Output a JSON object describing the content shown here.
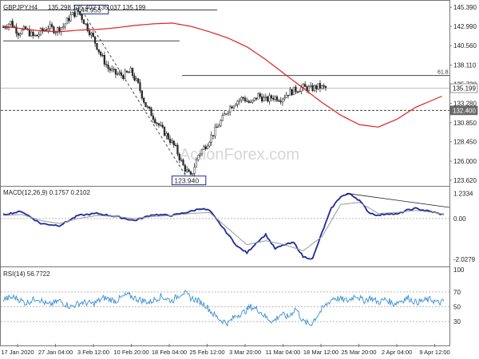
{
  "colors": {
    "candle": "#2b2b2b",
    "ma": "#e02020",
    "macd": "#1f2a9a",
    "signal": "#9a9a9a",
    "rsi": "#3a8fd6",
    "level": "#444444",
    "grid": "#b8b8b8",
    "watermark": "#d6d6d6",
    "box_border": "#1f2a9a"
  },
  "chart_data": [
    {
      "type": "candlestick",
      "title": "GBPJPY,H4",
      "ohlc_label": "135.298 135.402 135.037 135.199",
      "watermark": "ActionForex.com",
      "y_ticks": [
        "145.390",
        "142.990",
        "140.560",
        "138.110",
        "135.720",
        "133.280",
        "130.850",
        "128.450",
        "126.000",
        "123.620"
      ],
      "ylim": [
        123.0,
        146.0
      ],
      "levels": [
        {
          "label": "144.955",
          "value": 144.955
        },
        {
          "label": "123.940",
          "value": 123.94
        },
        {
          "label": "61.8",
          "value": 136.8
        },
        {
          "label": "132.400",
          "value": 132.4
        }
      ],
      "last_price_label": "135.199",
      "last_price": 135.199,
      "close_path": {
        "t": [
          0,
          4,
          8,
          12,
          16,
          18,
          20,
          24,
          28,
          32,
          36,
          40,
          44,
          48,
          52,
          56,
          60,
          64,
          68,
          72,
          76,
          80,
          84,
          88,
          92,
          96,
          100,
          104,
          108,
          112,
          116,
          120,
          124,
          128,
          132,
          136,
          140,
          144,
          148,
          152,
          156,
          160,
          164,
          168,
          172,
          176,
          180,
          184,
          188,
          192,
          196,
          200,
          204,
          208,
          212,
          216,
          220,
          224,
          228,
          232,
          235
        ],
        "values": [
          142.9,
          143.5,
          142.2,
          142.6,
          141.7,
          141.8,
          142.3,
          142.9,
          142.5,
          143.0,
          144.3,
          144.9,
          143.2,
          141.5,
          139.4,
          137.7,
          137.0,
          136.8,
          137.3,
          135.6,
          133.0,
          131.6,
          130.2,
          129.0,
          127.6,
          125.4,
          124.0,
          126.8,
          128.0,
          129.5,
          131.0,
          132.6,
          133.5,
          134.0,
          133.2,
          134.3,
          133.7,
          134.1,
          133.9,
          134.6,
          135.0,
          135.3,
          135.1,
          135.4,
          135.2
        ]
      },
      "ma_path": {
        "t": [
          0,
          10,
          20,
          30,
          40,
          50,
          60,
          70,
          80,
          90,
          100,
          110,
          120,
          130,
          140,
          150,
          160,
          170,
          180,
          190,
          200,
          210,
          220,
          230,
          235
        ],
        "values": [
          143.0,
          142.7,
          142.4,
          142.3,
          142.5,
          142.6,
          142.8,
          143.1,
          143.3,
          143.4,
          143.0,
          142.3,
          141.5,
          140.4,
          138.8,
          137.0,
          135.2,
          133.4,
          131.8,
          130.6,
          130.3,
          131.3,
          132.8,
          133.8,
          134.3
        ]
      }
    },
    {
      "type": "line",
      "title": "MACD(12,26,9) 0.1757 0.2102",
      "y_ticks": [
        "1.2334",
        "0.00",
        "-2.0279"
      ],
      "ylim": [
        -2.3,
        1.5
      ],
      "series": [
        {
          "name": "",
          "key": "macd",
          "t": [
            0,
            10,
            20,
            30,
            40,
            50,
            60,
            70,
            80,
            90,
            100,
            105,
            110,
            115,
            120,
            125,
            130,
            135,
            140,
            145,
            150,
            155,
            160,
            165,
            170,
            175,
            180,
            185,
            190,
            195,
            200,
            205,
            210,
            215,
            220,
            225,
            230,
            235
          ],
          "values": [
            0.2,
            0.35,
            -0.25,
            -0.35,
            0.15,
            0.25,
            0.1,
            -0.1,
            0.2,
            0.15,
            0.35,
            0.5,
            0.4,
            -0.2,
            -0.8,
            -1.4,
            -1.7,
            -1.2,
            -0.8,
            -1.5,
            -1.3,
            -1.2,
            -1.9,
            -2.0,
            -0.7,
            0.5,
            1.1,
            1.23,
            0.9,
            0.3,
            0.15,
            0.25,
            0.2,
            0.4,
            0.5,
            0.4,
            0.3,
            0.18
          ]
        },
        {
          "name": "",
          "key": "signal",
          "t": [
            0,
            10,
            20,
            30,
            40,
            50,
            60,
            70,
            80,
            90,
            100,
            110,
            120,
            130,
            140,
            150,
            160,
            170,
            180,
            190,
            200,
            210,
            220,
            230,
            235
          ],
          "values": [
            0.15,
            0.2,
            -0.1,
            -0.25,
            0.0,
            0.15,
            0.1,
            0.0,
            0.1,
            0.15,
            0.25,
            0.3,
            -0.5,
            -1.3,
            -1.1,
            -1.3,
            -1.6,
            -0.9,
            0.7,
            0.8,
            0.25,
            0.3,
            0.4,
            0.3,
            0.21
          ]
        }
      ]
    },
    {
      "type": "line",
      "title": "RSI(14) 56.7722",
      "y_ticks": [
        "100",
        "70",
        "50",
        "30",
        "0"
      ],
      "ylim": [
        0,
        100
      ],
      "series": [
        {
          "name": "",
          "key": "rsi",
          "t": [
            0,
            6,
            12,
            18,
            24,
            30,
            36,
            42,
            48,
            54,
            60,
            66,
            72,
            78,
            84,
            90,
            96,
            100,
            104,
            108,
            112,
            116,
            120,
            124,
            128,
            132,
            136,
            140,
            144,
            148,
            152,
            156,
            160,
            164,
            168,
            172,
            176,
            180,
            184,
            188,
            192,
            196,
            200,
            204,
            208,
            212,
            216,
            220,
            224,
            228,
            232,
            235
          ],
          "values": [
            60,
            63,
            55,
            62,
            52,
            58,
            50,
            56,
            54,
            62,
            58,
            66,
            60,
            56,
            64,
            58,
            70,
            62,
            58,
            52,
            40,
            32,
            28,
            38,
            42,
            50,
            46,
            36,
            30,
            40,
            36,
            48,
            30,
            26,
            40,
            52,
            62,
            60,
            58,
            66,
            58,
            62,
            56,
            60,
            54,
            58,
            62,
            56,
            58,
            60,
            55,
            57
          ]
        }
      ]
    }
  ],
  "x_ticks": [
    "17 Jan 2020",
    "27 Jan 04:00",
    "3 Feb 12:00",
    "10 Feb 20:00",
    "18 Feb 04:00",
    "25 Feb 12:00",
    "3 Mar 20:00",
    "11 Mar 04:00",
    "18 Mar 12:00",
    "25 Mar 20:00",
    "2 Apr 04:00",
    "9 Apr 12:00"
  ]
}
